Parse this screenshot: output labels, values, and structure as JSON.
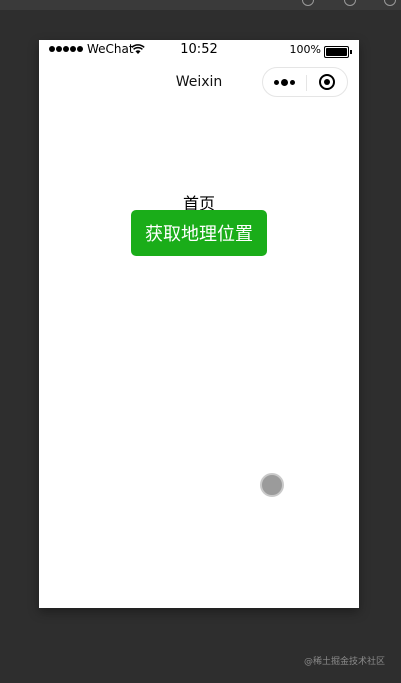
{
  "status_bar": {
    "carrier": "WeChat",
    "time": "10:52",
    "battery": "100%"
  },
  "nav": {
    "title": "Weixin"
  },
  "page": {
    "title": "首页",
    "locate_button": "获取地理位置"
  },
  "colors": {
    "primary_button": "#1aad19",
    "background": "#2e2e2e",
    "page": "#ffffff"
  },
  "watermark": "@稀土掘金技术社区"
}
